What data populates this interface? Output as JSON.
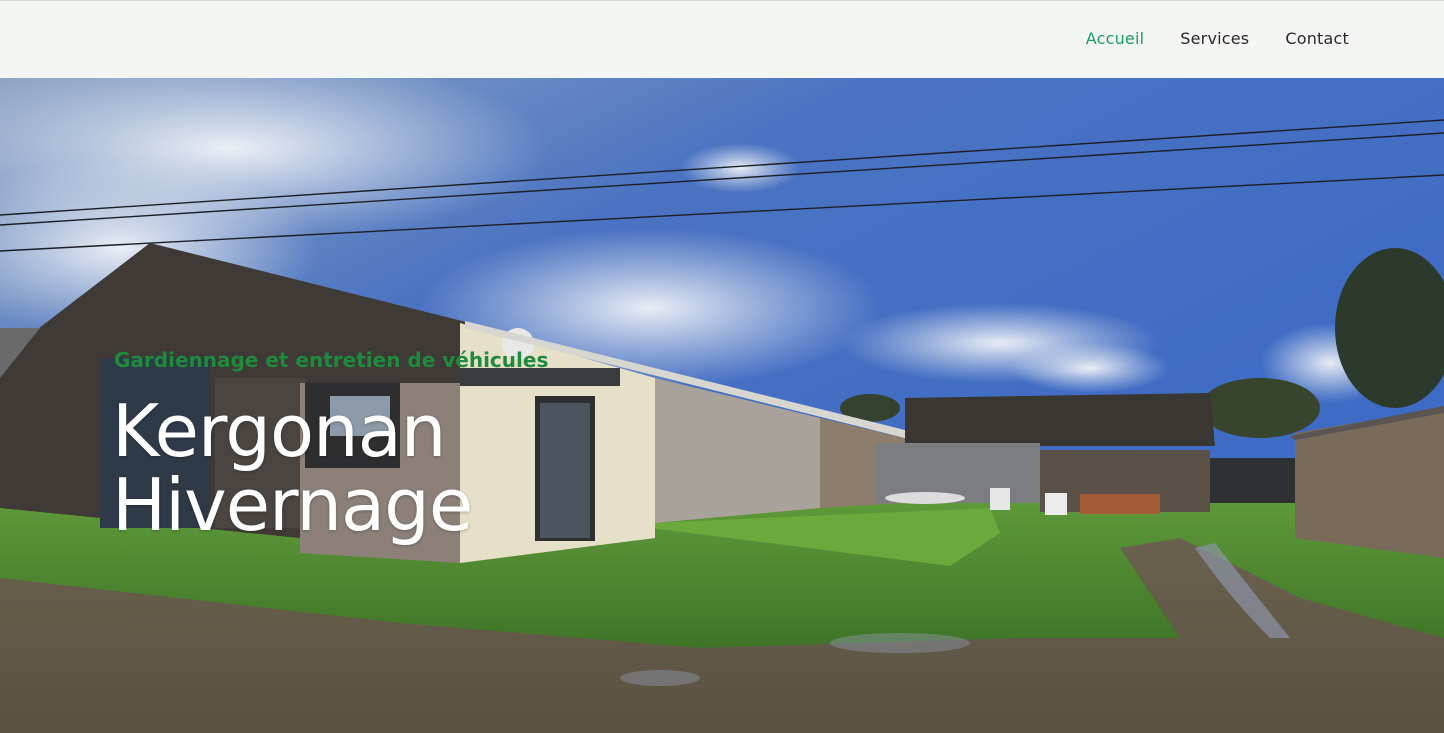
{
  "nav": {
    "items": [
      {
        "label": "Accueil",
        "active": true
      },
      {
        "label": "Services",
        "active": false
      },
      {
        "label": "Contact",
        "active": false
      }
    ]
  },
  "hero": {
    "subtitle": "Gardiennage et entretien de véhicules",
    "title_line1": "Kergonan",
    "title_line2": "Hivernage"
  },
  "colors": {
    "accent": "#1e9a63",
    "subtitle": "#1d8a3c",
    "header_bg": "#f3f5f2"
  }
}
